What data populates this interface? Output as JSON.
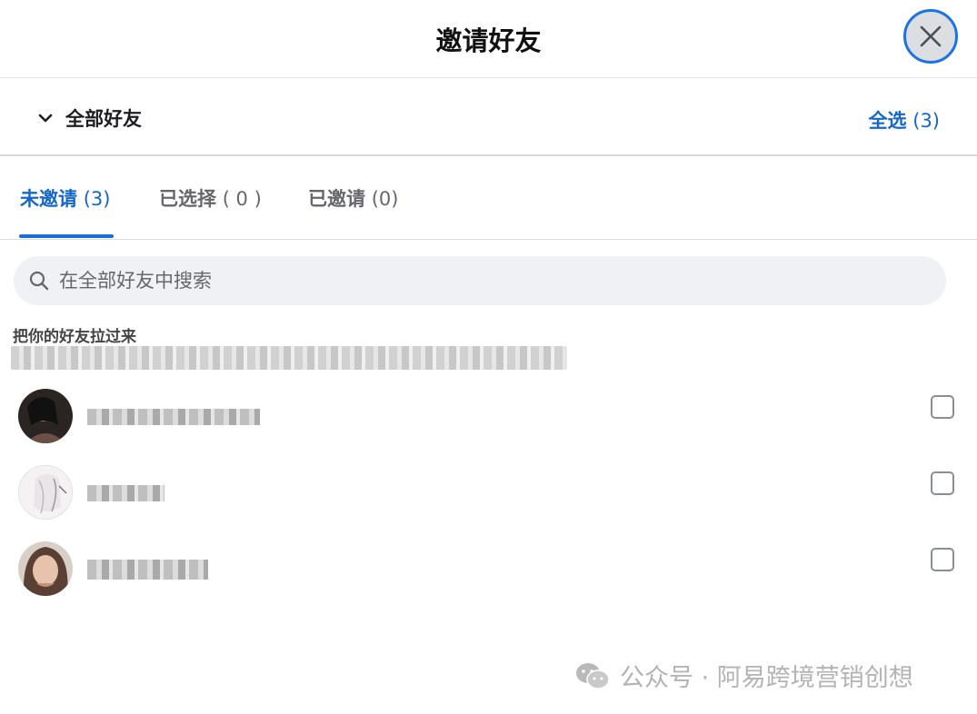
{
  "dialog": {
    "title": "邀请好友",
    "close_icon": "close-icon"
  },
  "group": {
    "label": "全部好友",
    "chevron_icon": "chevron-down-icon",
    "select_all_label": "全选",
    "select_all_count": "(3)"
  },
  "tabs": [
    {
      "label": "未邀请",
      "count": "(3)",
      "active": true
    },
    {
      "label": "已选择",
      "count": "( 0 )",
      "active": false
    },
    {
      "label": "已邀请",
      "count": "(0)",
      "active": false
    }
  ],
  "search": {
    "placeholder": "在全部好友中搜索",
    "value": "",
    "icon": "search-icon"
  },
  "section": {
    "title": "把你的好友拉过来"
  },
  "friends": [
    {
      "checked": false
    },
    {
      "checked": false
    },
    {
      "checked": false
    }
  ],
  "watermark": {
    "text": "公众号 · 阿易跨境营销创想",
    "icon": "wechat-icon"
  },
  "colors": {
    "accent": "#1467c9",
    "close_ring": "#1a73e8",
    "search_bg": "#eff1f4"
  }
}
